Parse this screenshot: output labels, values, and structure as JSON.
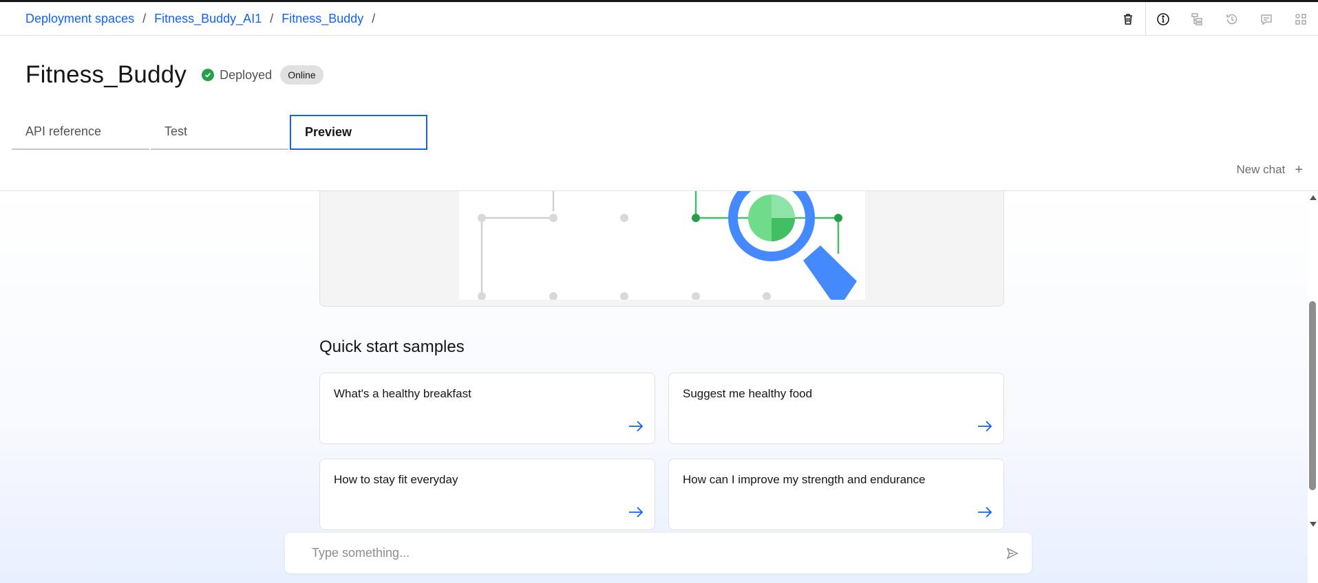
{
  "breadcrumb": {
    "items": [
      "Deployment spaces",
      "Fitness_Buddy_AI1",
      "Fitness_Buddy"
    ],
    "separator": "/"
  },
  "page": {
    "title": "Fitness_Buddy",
    "status": "Deployed",
    "tag": "Online"
  },
  "tabs": [
    {
      "label": "API reference"
    },
    {
      "label": "Test"
    },
    {
      "label": "Preview"
    }
  ],
  "chat": {
    "new_chat_label": "New chat",
    "quick_start_title": "Quick start samples",
    "samples": [
      {
        "text": "What's a healthy breakfast"
      },
      {
        "text": "Suggest me healthy food"
      },
      {
        "text": "How to stay fit everyday"
      },
      {
        "text": "How can I improve my strength and endurance"
      }
    ],
    "input_placeholder": "Type something..."
  },
  "colors": {
    "accent": "#0f62fe",
    "success": "#24a148",
    "text": "#161616",
    "muted": "#525252"
  },
  "icons": {
    "toolbar": [
      "trash-icon",
      "info-icon",
      "tree-icon",
      "history-icon",
      "comment-icon",
      "apps-icon"
    ]
  }
}
